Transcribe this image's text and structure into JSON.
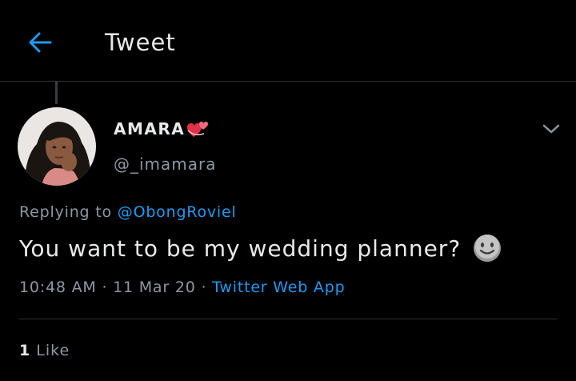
{
  "header": {
    "title": "Tweet",
    "back_icon": "arrow-left-icon"
  },
  "tweet": {
    "author_name": "AMARA",
    "author_badge_icon": "revolving-hearts-icon",
    "author_handle": "@_imamara",
    "replying_prefix": "Replying to",
    "replying_to": "@ObongRoviel",
    "text": "You want to be my wedding planner?",
    "text_emoji_icon": "smiling-face-emoji-icon",
    "time": "10:48 AM",
    "date": "11 Mar 20",
    "source": "Twitter Web App",
    "like_count": "1",
    "like_label": "Like"
  },
  "colors": {
    "background": "#000000",
    "accent": "#1d9bf0",
    "text": "#e7e9ea",
    "secondary_text": "#8b98a5",
    "divider": "#2f3336"
  }
}
